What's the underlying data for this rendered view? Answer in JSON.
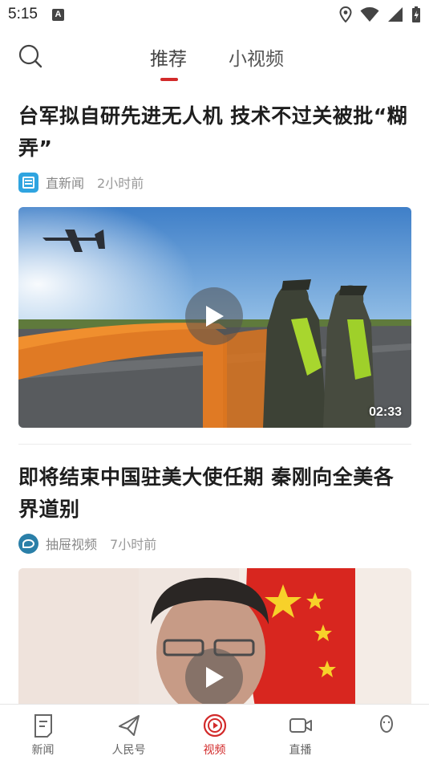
{
  "status_bar": {
    "time": "5:15",
    "notification_badge": "A"
  },
  "header": {
    "tabs": [
      {
        "label": "推荐",
        "active": true
      },
      {
        "label": "小视频",
        "active": false
      }
    ]
  },
  "articles": [
    {
      "title": "台军拟自研先进无人机 技术不过关被批“糊弄”",
      "source": "直新闻",
      "time": "2小时前",
      "duration": "02:33"
    },
    {
      "title": "即将结束中国驻美大使任期 秦刚向全美各界道别",
      "source": "抽屉视频",
      "time": "7小时前"
    }
  ],
  "bottom_nav": {
    "items": [
      {
        "label": "新闻",
        "icon": "news-icon"
      },
      {
        "label": "人民号",
        "icon": "paper-plane-icon"
      },
      {
        "label": "视频",
        "icon": "video-play-icon",
        "active": true
      },
      {
        "label": "直播",
        "icon": "camera-icon"
      },
      {
        "label": "",
        "icon": "profile-icon"
      }
    ]
  },
  "colors": {
    "accent": "#d22a2a",
    "text_primary": "#1e1e1e",
    "text_secondary": "#888888"
  }
}
